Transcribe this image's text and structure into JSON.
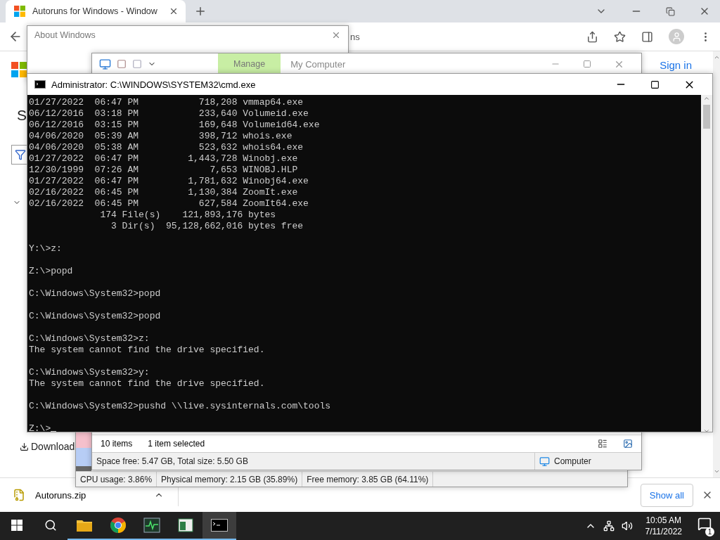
{
  "browser": {
    "tabs": [
      {
        "title": "Autoruns for Windows - Window",
        "selected": true
      }
    ],
    "address_fragment": "ns",
    "page": {
      "sign_in": "Sign in",
      "heading_fragment": "S",
      "download_fragment": "Download"
    },
    "download_shelf": {
      "file": "Autoruns.zip",
      "show_all": "Show all"
    }
  },
  "about_window": {
    "title": "About Windows"
  },
  "process_explorer": {
    "status": [
      "CPU usage: 3.86%",
      "Physical memory: 2.15 GB (35.89%)",
      "Free memory: 3.85 GB (64.11%)"
    ]
  },
  "explorer": {
    "tabs": [
      {
        "label": "Manage",
        "selected": true
      }
    ],
    "title": "My Computer",
    "status": {
      "items": "10 items",
      "selection": "1 item selected"
    },
    "details": {
      "space": "Space free: 5.47 GB, Total size: 5.50 GB",
      "location": "Computer"
    }
  },
  "cmd": {
    "title": "Administrator: C:\\WINDOWS\\SYSTEM32\\cmd.exe",
    "blocks": [
      [
        "01/27/2022  06:47 PM           718,208 vmmap64.exe",
        "06/12/2016  03:18 PM           233,640 Volumeid.exe",
        "06/12/2016  03:15 PM           169,648 Volumeid64.exe",
        "04/06/2020  05:39 AM           398,712 whois.exe",
        "04/06/2020  05:38 AM           523,632 whois64.exe",
        "01/27/2022  06:47 PM         1,443,728 Winobj.exe",
        "12/30/1999  07:26 AM             7,653 WINOBJ.HLP",
        "01/27/2022  06:47 PM         1,781,632 Winobj64.exe",
        "02/16/2022  06:45 PM         1,130,384 ZoomIt.exe",
        "02/16/2022  06:45 PM           627,584 ZoomIt64.exe",
        "             174 File(s)    121,893,176 bytes",
        "               3 Dir(s)  95,128,662,016 bytes free"
      ],
      [
        "Y:\\>z:"
      ],
      [
        "Z:\\>popd"
      ],
      [
        "C:\\Windows\\System32>popd"
      ],
      [
        "C:\\Windows\\System32>popd"
      ],
      [
        "C:\\Windows\\System32>z:",
        "The system cannot find the drive specified."
      ],
      [
        "C:\\Windows\\System32>y:",
        "The system cannot find the drive specified."
      ],
      [
        "C:\\Windows\\System32>pushd \\\\live.sysinternals.com\\tools"
      ],
      [
        "Z:\\>"
      ]
    ],
    "cursor": true
  },
  "taskbar": {
    "apps": [
      {
        "kind": "folder",
        "open": true,
        "selected": false
      },
      {
        "kind": "chrome",
        "open": true,
        "selected": false
      },
      {
        "kind": "monitor",
        "open": true,
        "selected": false
      },
      {
        "kind": "window",
        "open": true,
        "selected": false
      },
      {
        "kind": "console",
        "open": true,
        "selected": true
      }
    ],
    "time": "10:05 AM",
    "date": "7/11/2022",
    "notifications": "1"
  }
}
